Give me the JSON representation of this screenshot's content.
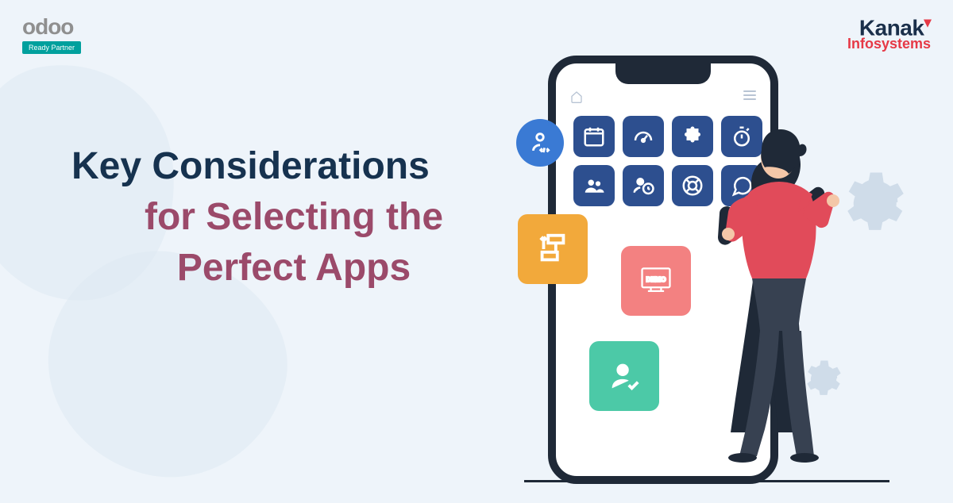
{
  "logos": {
    "odoo": "odoo",
    "odoo_badge": "Ready Partner",
    "kanak": "Kanak",
    "kanak_sub": "Infosystems"
  },
  "headline": {
    "line1": "Key Considerations",
    "line2": "for Selecting the",
    "line3": "Perfect Apps"
  },
  "phone_tiles": [
    "calendar-icon",
    "gauge-icon",
    "puzzle-icon",
    "stopwatch-icon",
    "group-icon",
    "time-user-icon",
    "lifebuoy-icon",
    "chat-icon"
  ],
  "floating_tiles": {
    "blue": "dev-user-icon",
    "orange": "flowchart-icon",
    "coral": "demo-icon",
    "coral_label": "DEMO",
    "teal": "user-check-icon"
  },
  "colors": {
    "bg": "#eef4fa",
    "navy": "#16324f",
    "mauve": "#9b4a6a",
    "tile_blue": "#2d4f8f",
    "accent_red": "#e63946",
    "badge_teal": "#00a09d"
  }
}
